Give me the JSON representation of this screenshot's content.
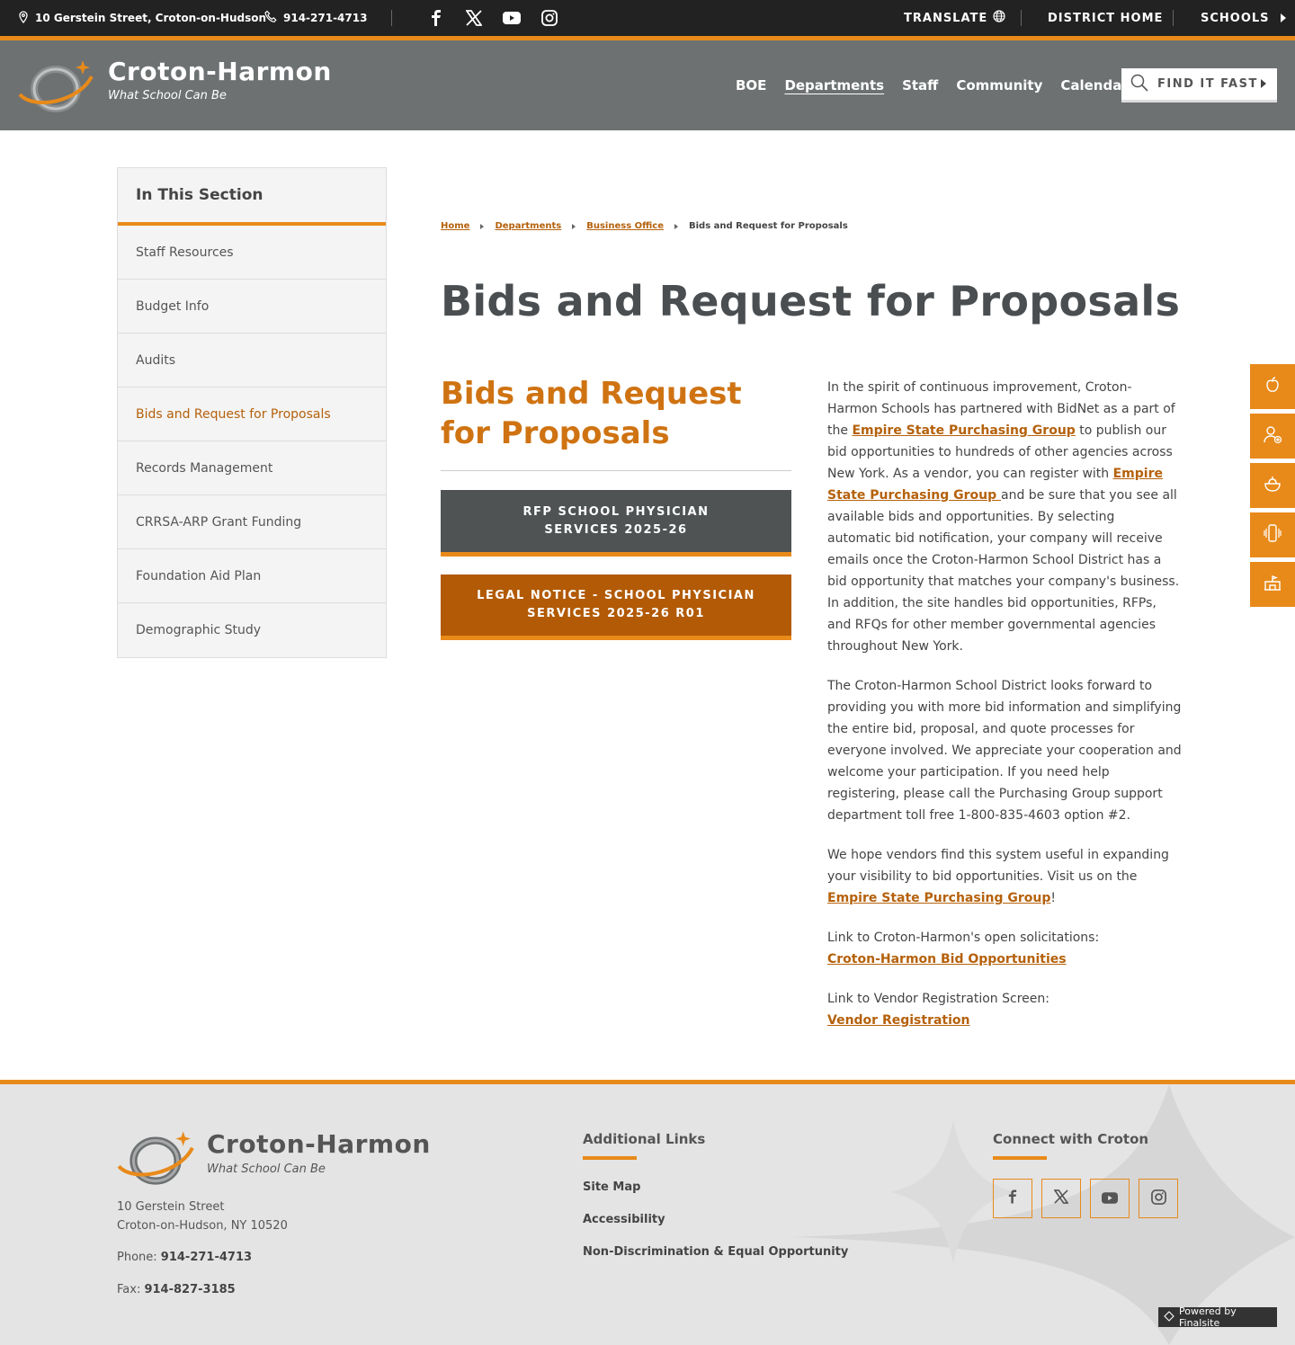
{
  "utility": {
    "address": "10 Gerstein Street, Croton-on-Hudson",
    "phone": "914-271-4713",
    "translate": "TRANSLATE",
    "district_home": "DISTRICT HOME",
    "schools": "SCHOOLS"
  },
  "header": {
    "title": "Croton-Harmon",
    "tagline": "What School Can Be",
    "nav": [
      "BOE",
      "Departments",
      "Staff",
      "Community",
      "Calendar"
    ],
    "active_nav": "Departments",
    "find_it_fast": "FIND IT FAST"
  },
  "sidebar": {
    "heading": "In This Section",
    "items": [
      "Staff Resources",
      "Budget Info",
      "Audits",
      "Bids and Request for Proposals",
      "Records Management",
      "CRRSA-ARP Grant Funding",
      "Foundation Aid Plan",
      "Demographic Study"
    ],
    "active_item": "Bids and Request for Proposals"
  },
  "breadcrumb": [
    "Home",
    "Departments",
    "Business Office",
    "Bids and Request for Proposals"
  ],
  "page_title": "Bids and Request for Proposals",
  "section_title": "Bids and Request for Proposals",
  "buttons": {
    "rfp_line1": "RFP SCHOOL PHYSICIAN",
    "rfp_line2": "SERVICES 2025-26",
    "legal_line1": "LEGAL NOTICE - SCHOOL PHYSICIAN",
    "legal_line2": "SERVICES 2025-26 R01"
  },
  "content": {
    "p1_a": "In the spirit of continuous improvement, Croton-Harmon Schools has partnered with BidNet as a part of the ",
    "p1_link1": "Empire State Purchasing Group",
    "p1_b": " to publish our bid opportunities to hundreds of other agencies across New York. As a vendor, you can register with ",
    "p1_link2": "Empire State Purchasing Group ",
    "p1_c": "and be sure that you see all available bids and opportunities. By selecting automatic bid notification, your company will receive emails once the Croton-Harmon School District has a bid opportunity that matches your company's business. In addition, the site handles bid opportunities, RFPs, and RFQs for other member governmental agencies throughout New York.",
    "p2": "The Croton-Harmon School District looks forward to providing you with more bid information and simplifying the entire bid, proposal, and quote processes for everyone involved.  We appreciate your cooperation and welcome your participation.  If you need help registering, please call the Purchasing Group support department toll free 1-800-835-4603 option #2.",
    "p3_a": "We hope vendors find this system useful in expanding your visibility to bid opportunities. Visit us on the ",
    "p3_link": "Empire State Purchasing Group",
    "p3_b": "!",
    "p4_label": "Link to Croton-Harmon's open solicitations:",
    "p4_link": "Croton-Harmon Bid Opportunities",
    "p5_label": "Link to Vendor Registration Screen:",
    "p5_link": "Vendor Registration"
  },
  "footer": {
    "title": "Croton-Harmon",
    "tagline": "What School Can Be",
    "address_line1": "10 Gerstein Street",
    "address_line2": "Croton-on-Hudson, NY  10520",
    "phone_label": "Phone: ",
    "phone": "914-271-4713",
    "fax_label": "Fax: ",
    "fax": "914-827-3185",
    "additional_heading": "Additional Links",
    "links": [
      "Site Map",
      "Accessibility",
      "Non-Discrimination & Equal Opportunity"
    ],
    "connect_heading": "Connect with Croton",
    "powered": "Powered by Finalsite"
  },
  "colors": {
    "accent": "#e88a1a",
    "link": "#b5610b",
    "header_bg": "#6d7172"
  },
  "icons": [
    "location-pin-icon",
    "phone-icon",
    "facebook-icon",
    "x-icon",
    "youtube-icon",
    "instagram-icon",
    "globe-icon",
    "search-icon",
    "apple-icon",
    "user-plus-icon",
    "food-icon",
    "mobile-icon",
    "school-icon"
  ]
}
